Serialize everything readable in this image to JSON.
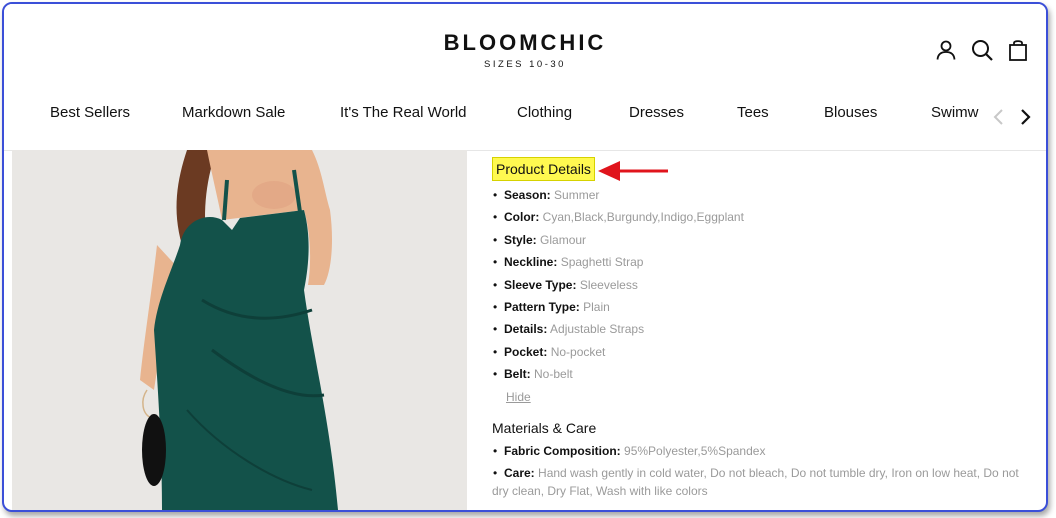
{
  "header": {
    "brand": "BLOOMCHIC",
    "tagline": "SIZES 10-30",
    "icons": [
      "account-icon",
      "search-icon",
      "shopping-bag-icon"
    ]
  },
  "nav": {
    "items": [
      "Best Sellers",
      "Markdown Sale",
      "It's The Real World",
      "Clothing",
      "Dresses",
      "Tees",
      "Blouses",
      "Swimw"
    ]
  },
  "product_details": {
    "title": "Product Details",
    "items": [
      {
        "label": "Season:",
        "value": "Summer"
      },
      {
        "label": "Color:",
        "value": "Cyan,Black,Burgundy,Indigo,Eggplant"
      },
      {
        "label": "Style:",
        "value": "Glamour"
      },
      {
        "label": "Neckline:",
        "value": "Spaghetti Strap"
      },
      {
        "label": "Sleeve Type:",
        "value": "Sleeveless"
      },
      {
        "label": "Pattern Type:",
        "value": "Plain"
      },
      {
        "label": "Details:",
        "value": "Adjustable Straps"
      },
      {
        "label": "Pocket:",
        "value": "No-pocket"
      },
      {
        "label": "Belt:",
        "value": "No-belt"
      }
    ],
    "hide_link": "Hide"
  },
  "materials": {
    "title": "Materials & Care",
    "items": [
      {
        "label": "Fabric Composition:",
        "value": "95%Polyester,5%Spandex"
      },
      {
        "label": "Care:",
        "value": "Hand wash gently in cold water, Do not bleach, Do not tumble dry, Iron on low heat, Do not dry clean, Dry Flat, Wash with like colors"
      }
    ]
  },
  "colors": {
    "highlight": "#fff950",
    "arrow": "#e0141c",
    "frame_border": "#3b4fd8",
    "dress": "#13524a"
  }
}
